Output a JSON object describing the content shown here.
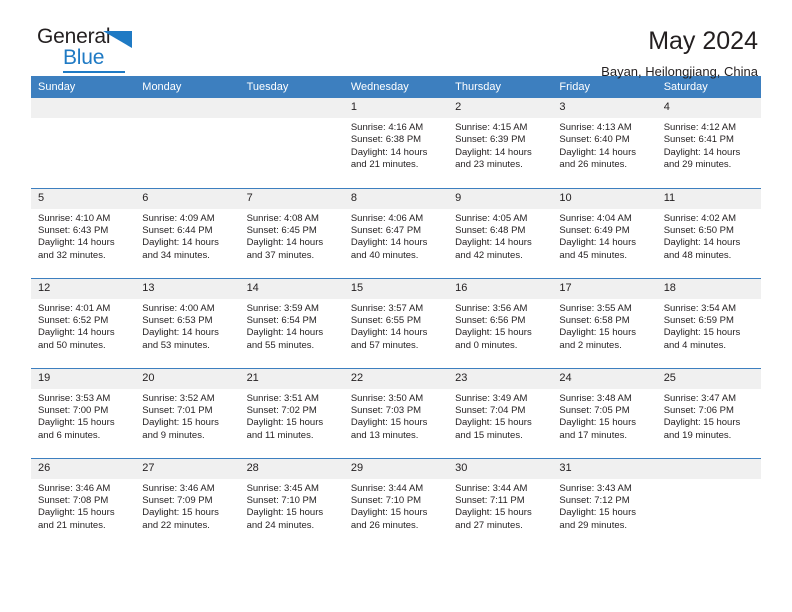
{
  "logo": {
    "line1": "General",
    "line2": "Blue",
    "triangle_icon": "triangle-icon",
    "brand_color": "#1f7ac4",
    "text_color": "#231f20"
  },
  "header": {
    "title": "May 2024",
    "subtitle": "Bayan, Heilongjiang, China",
    "header_bg": "#3d7fbf",
    "header_text": "#ffffff"
  },
  "calendar": {
    "weekday_headers": [
      "Sunday",
      "Monday",
      "Tuesday",
      "Wednesday",
      "Thursday",
      "Friday",
      "Saturday"
    ],
    "weeks": [
      [
        {
          "day": "",
          "lines": []
        },
        {
          "day": "",
          "lines": []
        },
        {
          "day": "",
          "lines": []
        },
        {
          "day": "1",
          "lines": [
            "Sunrise: 4:16 AM",
            "Sunset: 6:38 PM",
            "Daylight: 14 hours",
            "and 21 minutes."
          ]
        },
        {
          "day": "2",
          "lines": [
            "Sunrise: 4:15 AM",
            "Sunset: 6:39 PM",
            "Daylight: 14 hours",
            "and 23 minutes."
          ]
        },
        {
          "day": "3",
          "lines": [
            "Sunrise: 4:13 AM",
            "Sunset: 6:40 PM",
            "Daylight: 14 hours",
            "and 26 minutes."
          ]
        },
        {
          "day": "4",
          "lines": [
            "Sunrise: 4:12 AM",
            "Sunset: 6:41 PM",
            "Daylight: 14 hours",
            "and 29 minutes."
          ]
        }
      ],
      [
        {
          "day": "5",
          "lines": [
            "Sunrise: 4:10 AM",
            "Sunset: 6:43 PM",
            "Daylight: 14 hours",
            "and 32 minutes."
          ]
        },
        {
          "day": "6",
          "lines": [
            "Sunrise: 4:09 AM",
            "Sunset: 6:44 PM",
            "Daylight: 14 hours",
            "and 34 minutes."
          ]
        },
        {
          "day": "7",
          "lines": [
            "Sunrise: 4:08 AM",
            "Sunset: 6:45 PM",
            "Daylight: 14 hours",
            "and 37 minutes."
          ]
        },
        {
          "day": "8",
          "lines": [
            "Sunrise: 4:06 AM",
            "Sunset: 6:47 PM",
            "Daylight: 14 hours",
            "and 40 minutes."
          ]
        },
        {
          "day": "9",
          "lines": [
            "Sunrise: 4:05 AM",
            "Sunset: 6:48 PM",
            "Daylight: 14 hours",
            "and 42 minutes."
          ]
        },
        {
          "day": "10",
          "lines": [
            "Sunrise: 4:04 AM",
            "Sunset: 6:49 PM",
            "Daylight: 14 hours",
            "and 45 minutes."
          ]
        },
        {
          "day": "11",
          "lines": [
            "Sunrise: 4:02 AM",
            "Sunset: 6:50 PM",
            "Daylight: 14 hours",
            "and 48 minutes."
          ]
        }
      ],
      [
        {
          "day": "12",
          "lines": [
            "Sunrise: 4:01 AM",
            "Sunset: 6:52 PM",
            "Daylight: 14 hours",
            "and 50 minutes."
          ]
        },
        {
          "day": "13",
          "lines": [
            "Sunrise: 4:00 AM",
            "Sunset: 6:53 PM",
            "Daylight: 14 hours",
            "and 53 minutes."
          ]
        },
        {
          "day": "14",
          "lines": [
            "Sunrise: 3:59 AM",
            "Sunset: 6:54 PM",
            "Daylight: 14 hours",
            "and 55 minutes."
          ]
        },
        {
          "day": "15",
          "lines": [
            "Sunrise: 3:57 AM",
            "Sunset: 6:55 PM",
            "Daylight: 14 hours",
            "and 57 minutes."
          ]
        },
        {
          "day": "16",
          "lines": [
            "Sunrise: 3:56 AM",
            "Sunset: 6:56 PM",
            "Daylight: 15 hours",
            "and 0 minutes."
          ]
        },
        {
          "day": "17",
          "lines": [
            "Sunrise: 3:55 AM",
            "Sunset: 6:58 PM",
            "Daylight: 15 hours",
            "and 2 minutes."
          ]
        },
        {
          "day": "18",
          "lines": [
            "Sunrise: 3:54 AM",
            "Sunset: 6:59 PM",
            "Daylight: 15 hours",
            "and 4 minutes."
          ]
        }
      ],
      [
        {
          "day": "19",
          "lines": [
            "Sunrise: 3:53 AM",
            "Sunset: 7:00 PM",
            "Daylight: 15 hours",
            "and 6 minutes."
          ]
        },
        {
          "day": "20",
          "lines": [
            "Sunrise: 3:52 AM",
            "Sunset: 7:01 PM",
            "Daylight: 15 hours",
            "and 9 minutes."
          ]
        },
        {
          "day": "21",
          "lines": [
            "Sunrise: 3:51 AM",
            "Sunset: 7:02 PM",
            "Daylight: 15 hours",
            "and 11 minutes."
          ]
        },
        {
          "day": "22",
          "lines": [
            "Sunrise: 3:50 AM",
            "Sunset: 7:03 PM",
            "Daylight: 15 hours",
            "and 13 minutes."
          ]
        },
        {
          "day": "23",
          "lines": [
            "Sunrise: 3:49 AM",
            "Sunset: 7:04 PM",
            "Daylight: 15 hours",
            "and 15 minutes."
          ]
        },
        {
          "day": "24",
          "lines": [
            "Sunrise: 3:48 AM",
            "Sunset: 7:05 PM",
            "Daylight: 15 hours",
            "and 17 minutes."
          ]
        },
        {
          "day": "25",
          "lines": [
            "Sunrise: 3:47 AM",
            "Sunset: 7:06 PM",
            "Daylight: 15 hours",
            "and 19 minutes."
          ]
        }
      ],
      [
        {
          "day": "26",
          "lines": [
            "Sunrise: 3:46 AM",
            "Sunset: 7:08 PM",
            "Daylight: 15 hours",
            "and 21 minutes."
          ]
        },
        {
          "day": "27",
          "lines": [
            "Sunrise: 3:46 AM",
            "Sunset: 7:09 PM",
            "Daylight: 15 hours",
            "and 22 minutes."
          ]
        },
        {
          "day": "28",
          "lines": [
            "Sunrise: 3:45 AM",
            "Sunset: 7:10 PM",
            "Daylight: 15 hours",
            "and 24 minutes."
          ]
        },
        {
          "day": "29",
          "lines": [
            "Sunrise: 3:44 AM",
            "Sunset: 7:10 PM",
            "Daylight: 15 hours",
            "and 26 minutes."
          ]
        },
        {
          "day": "30",
          "lines": [
            "Sunrise: 3:44 AM",
            "Sunset: 7:11 PM",
            "Daylight: 15 hours",
            "and 27 minutes."
          ]
        },
        {
          "day": "31",
          "lines": [
            "Sunrise: 3:43 AM",
            "Sunset: 7:12 PM",
            "Daylight: 15 hours",
            "and 29 minutes."
          ]
        },
        {
          "day": "",
          "lines": []
        }
      ]
    ]
  }
}
